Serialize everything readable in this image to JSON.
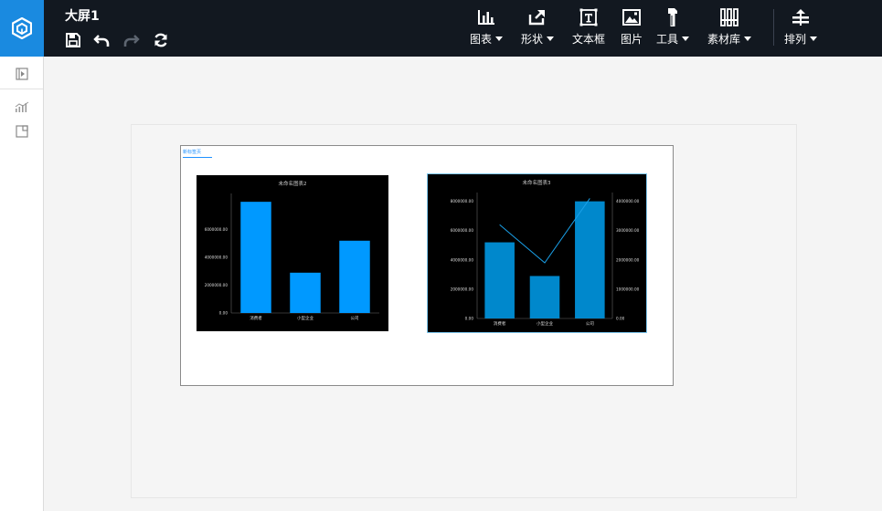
{
  "app": {
    "title": "大屏1"
  },
  "toolbar": {
    "items": [
      {
        "label": "图表",
        "icon": "bar-chart-icon",
        "has_dropdown": true
      },
      {
        "label": "形状",
        "icon": "shape-icon",
        "has_dropdown": true
      },
      {
        "label": "文本框",
        "icon": "textbox-icon",
        "has_dropdown": false
      },
      {
        "label": "图片",
        "icon": "image-icon",
        "has_dropdown": false
      },
      {
        "label": "工具",
        "icon": "tools-icon",
        "has_dropdown": true
      },
      {
        "label": "素材库",
        "icon": "library-icon",
        "has_dropdown": true
      },
      {
        "label": "排列",
        "icon": "arrange-icon",
        "has_dropdown": true
      }
    ]
  },
  "board": {
    "tag_label": "新标签页"
  },
  "colors": {
    "topbar": "#121820",
    "logo_bg": "#1a8ae0",
    "bar1": "#0099ff",
    "bar2": "#0088cc",
    "line": "#1aa0e8",
    "selected_border": "#7fc8f0"
  },
  "chart_data": [
    {
      "type": "bar",
      "title": "未命名图表2",
      "categories": [
        "消费者",
        "小型企业",
        "公司"
      ],
      "values": [
        8000000,
        2900000,
        5200000
      ],
      "yticks": [
        "0.00",
        "2000000.00",
        "4000000.00",
        "6000000.00"
      ],
      "ylim": [
        0,
        8600000
      ]
    },
    {
      "type": "bar",
      "title": "未命名图表3",
      "categories": [
        "消费者",
        "小型企业",
        "公司"
      ],
      "series": [
        {
          "type": "bar",
          "axis": "left",
          "values": [
            5200000,
            2900000,
            8000000
          ]
        },
        {
          "type": "line",
          "axis": "right",
          "values": [
            3200000,
            1900000,
            4100000
          ]
        }
      ],
      "yticks_left": [
        "0.00",
        "2000000.00",
        "4000000.00",
        "6000000.00",
        "8000000.00"
      ],
      "yticks_right": [
        "0.00",
        "1000000.00",
        "2000000.00",
        "3000000.00",
        "4000000.00"
      ],
      "ylim_left": [
        0,
        8600000
      ],
      "ylim_right": [
        0,
        4300000
      ]
    }
  ]
}
